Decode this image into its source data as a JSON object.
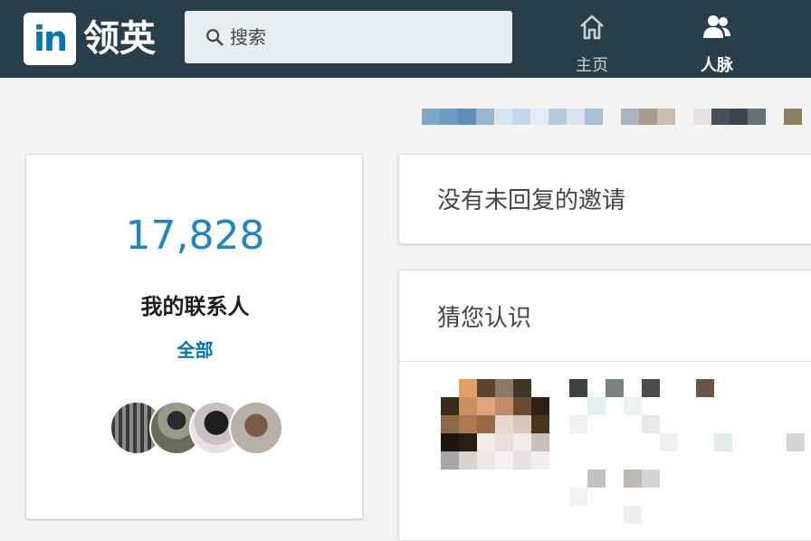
{
  "header": {
    "logo_text": "in",
    "brand": "领英",
    "search": {
      "placeholder": "搜索",
      "icon": "search-icon"
    },
    "nav": [
      {
        "label": "主页",
        "icon": "home-icon"
      },
      {
        "label": "人脉",
        "icon": "people-icon"
      }
    ]
  },
  "connections_card": {
    "count": "17,828",
    "label": "我的联系人",
    "link": "全部"
  },
  "invitations_card": {
    "text": "没有未回复的邀请"
  },
  "pymk_card": {
    "title": "猜您认识"
  },
  "colors": {
    "header_bg": "#283e4a",
    "accent": "#0073b1",
    "count": "#1f86c1",
    "page_bg": "#f3f3f3"
  }
}
